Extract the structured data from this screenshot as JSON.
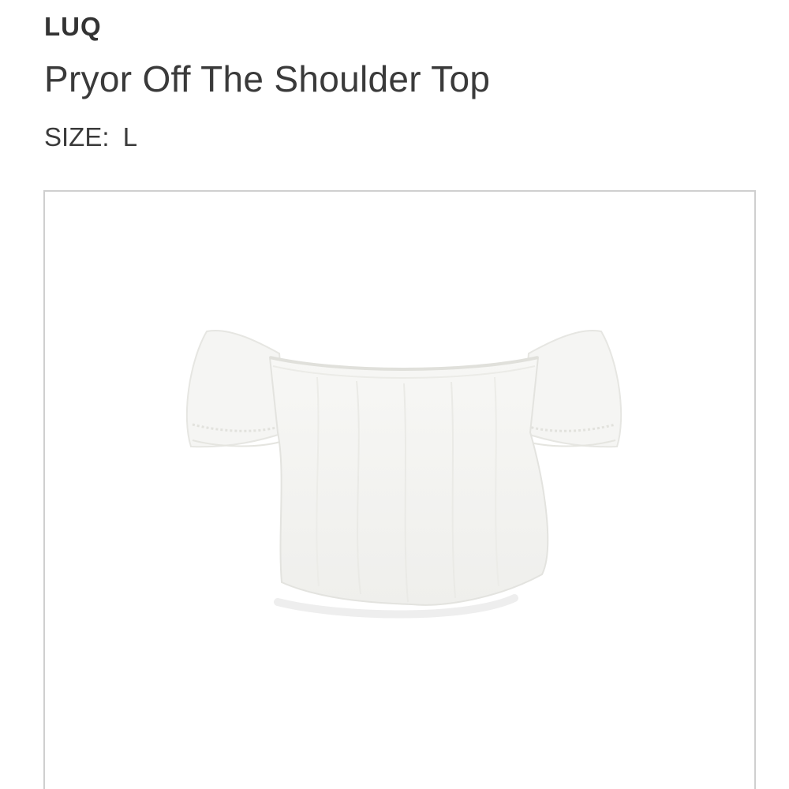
{
  "product": {
    "brand": "LUQ",
    "name": "Pryor Off The Shoulder Top",
    "size_label": "SIZE:",
    "size_value": "L",
    "image_icon": "off-shoulder-top-photo"
  }
}
